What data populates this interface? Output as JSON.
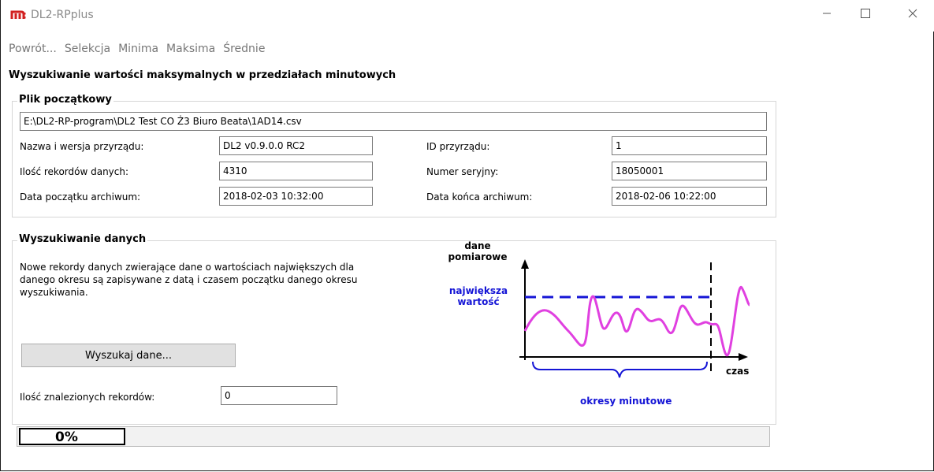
{
  "window": {
    "title": "DL2-RPplus"
  },
  "menu": [
    "Powrót...",
    "Selekcja",
    "Minima",
    "Maksima",
    "Średnie"
  ],
  "page_heading": "Wyszukiwanie wartości maksymalnych w przedziałach minutowych",
  "source_file": {
    "title": "Plik początkowy",
    "path": "E:\\DL2-RP-program\\DL2 Test CO Ż3 Biuro Beata\\1AD14.csv",
    "device_name_label": "Nazwa i wersja przyrządu:",
    "device_name_value": "DL2 v0.9.0.0 RC2",
    "device_id_label": "ID przyrządu:",
    "device_id_value": "1",
    "records_label": "Ilość rekordów danych:",
    "records_value": "4310",
    "serial_label": "Numer seryjny:",
    "serial_value": "18050001",
    "start_label": "Data początku archiwum:",
    "start_value": "2018-02-03 10:32:00",
    "end_label": "Data końca archiwum:",
    "end_value": "2018-02-06 10:22:00"
  },
  "search": {
    "title": "Wyszukiwanie danych",
    "description": "Nowe rekordy danych zwierające dane o wartościach największych dla danego okresu są zapisywane z datą i czasem początku danego okresu wyszukiwania.",
    "button_label": "Wyszukaj dane...",
    "found_label": "Ilość znalezionych rekordów:",
    "found_value": "0"
  },
  "diagram": {
    "y_label_line1": "dane",
    "y_label_line2": "pomiarowe",
    "max_label_line1": "największa",
    "max_label_line2": "wartość",
    "x_label": "czas",
    "period_label": "okresy minutowe",
    "colors": {
      "axis": "#000000",
      "max": "#1515d6",
      "signal": "#e040e0",
      "bracket": "#1515d6"
    }
  },
  "progress": {
    "percent": 0,
    "label": "0%"
  }
}
